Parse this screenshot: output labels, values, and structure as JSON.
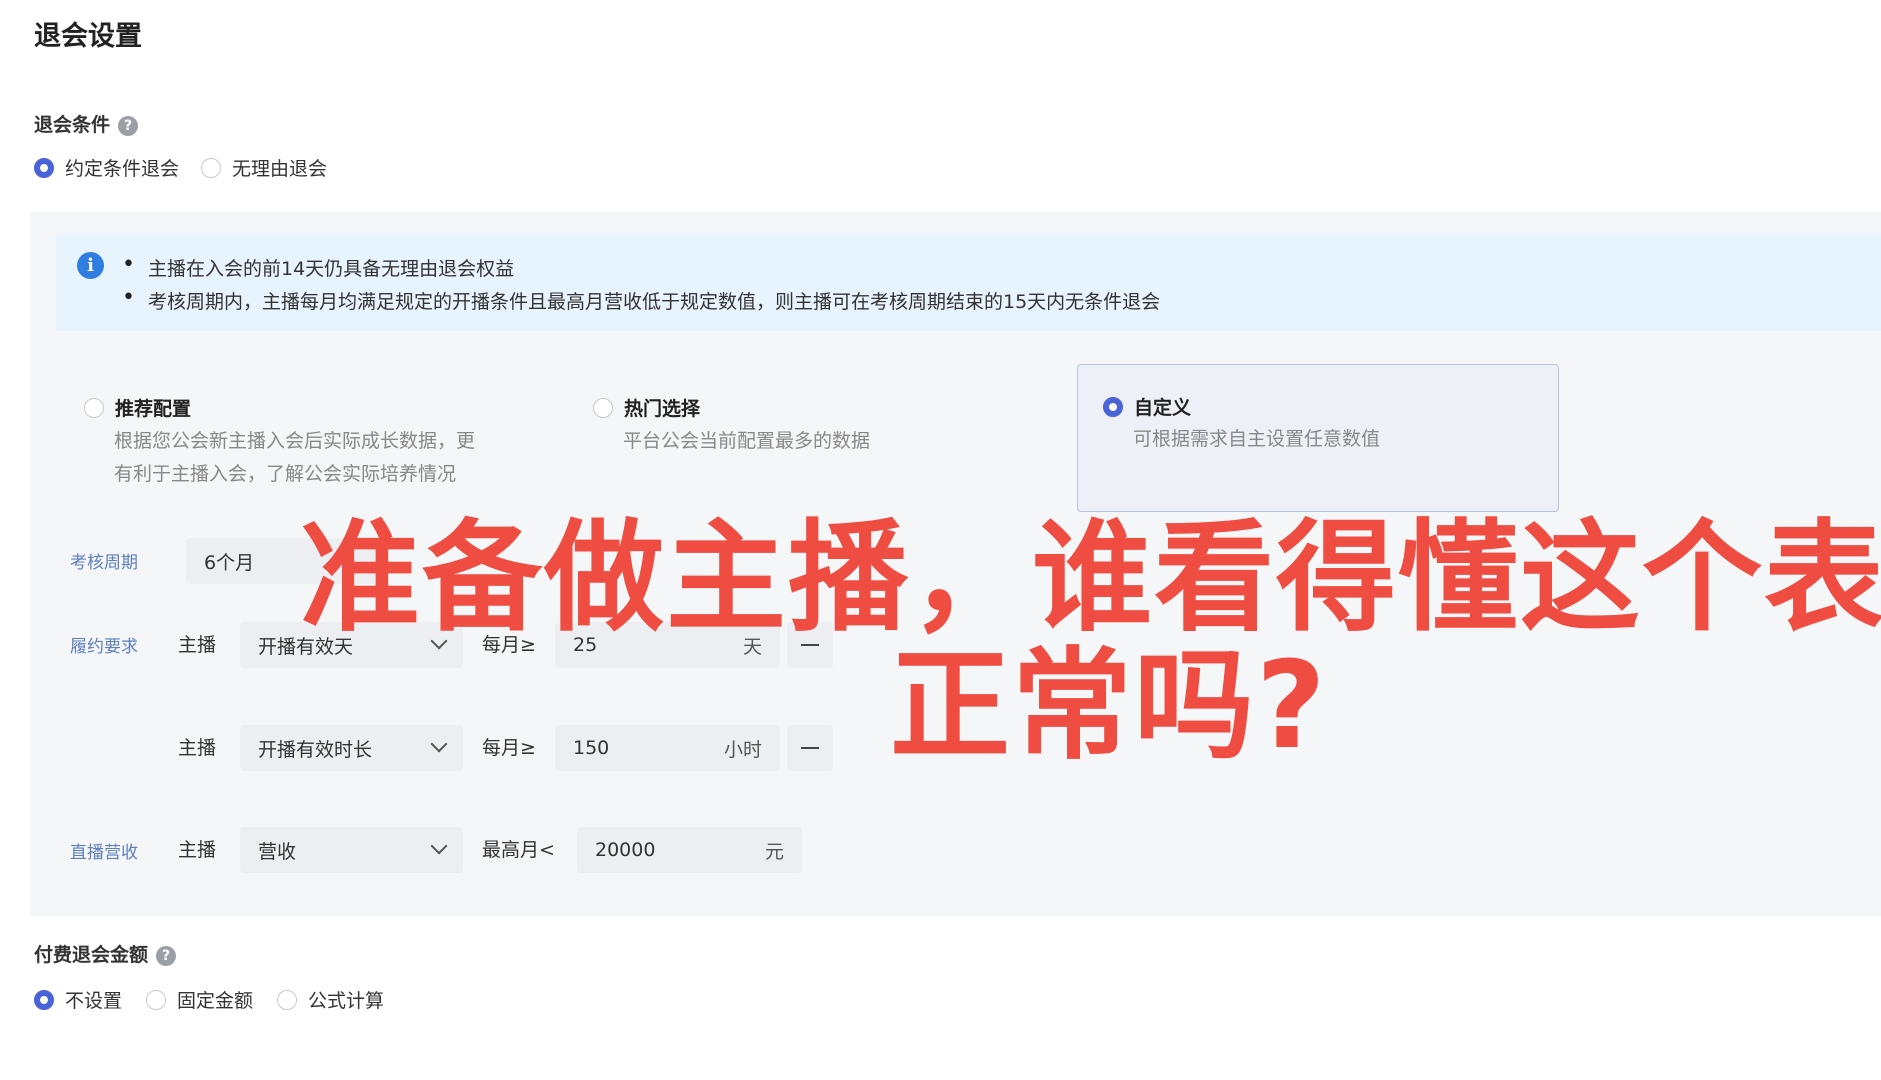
{
  "page": {
    "title": "退会设置"
  },
  "exit_condition": {
    "label": "退会条件",
    "help": "?",
    "options": [
      {
        "label": "约定条件退会",
        "selected": true
      },
      {
        "label": "无理由退会",
        "selected": false
      }
    ]
  },
  "info": {
    "icon": "i",
    "lines": [
      "主播在入会的前14天仍具备无理由退会权益",
      "考核周期内，主播每月均满足规定的开播条件且最高月营收低于规定数值，则主播可在考核周期结束的15天内无条件退会"
    ]
  },
  "config_cards": [
    {
      "title": "推荐配置",
      "desc_lines": [
        "根据您公会新主播入会后实际成长数据，更",
        "有利于主播入会，了解公会实际培养情况"
      ],
      "selected": false
    },
    {
      "title": "热门选择",
      "desc_lines": [
        "平台公会当前配置最多的数据"
      ],
      "selected": false
    },
    {
      "title": "自定义",
      "desc_lines": [
        "可根据需求自主设置任意数值"
      ],
      "selected": true
    }
  ],
  "assessment": {
    "period_label": "考核周期",
    "period_value": "6个月",
    "performance_label": "履约要求",
    "revenue_label": "直播营收",
    "rows": [
      {
        "subject": "主播",
        "metric": "开播有效天",
        "cond": "每月≥",
        "value": "25",
        "unit": "天"
      },
      {
        "subject": "主播",
        "metric": "开播有效时长",
        "cond": "每月≥",
        "value": "150",
        "unit": "小时"
      },
      {
        "subject": "主播",
        "metric": "营收",
        "cond": "最高月<",
        "value": "20000",
        "unit": "元"
      }
    ]
  },
  "paid_exit": {
    "label": "付费退会金额",
    "help": "?",
    "options": [
      {
        "label": "不设置",
        "selected": true
      },
      {
        "label": "固定金额",
        "selected": false
      },
      {
        "label": "公式计算",
        "selected": false
      }
    ]
  },
  "overlay": {
    "line1": "准备做主播，谁看得懂这个表?",
    "line2": "正常吗?"
  },
  "colors": {
    "accent": "#4a63d6",
    "overlay": "#ef4d42",
    "info_bg": "#e7f3fd"
  }
}
